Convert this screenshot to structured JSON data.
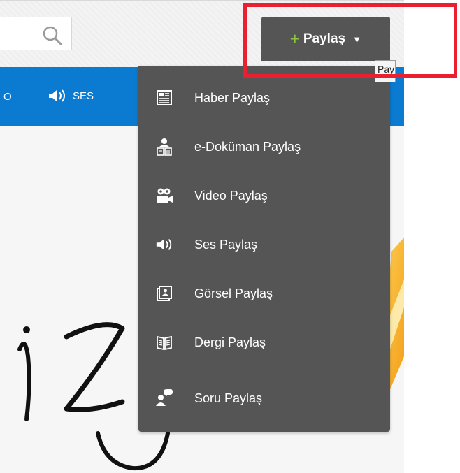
{
  "header": {
    "share_button": {
      "plus": "+",
      "label": "Paylaş",
      "caret": "▼"
    },
    "tooltip": "Paylaş"
  },
  "nav": {
    "item_partial": "O",
    "item_ses": "SES"
  },
  "dropdown": {
    "items": [
      {
        "label": "Haber Paylaş",
        "icon": "newspaper-icon"
      },
      {
        "label": "e-Doküman Paylaş",
        "icon": "document-share-icon"
      },
      {
        "label": "Video Paylaş",
        "icon": "video-camera-icon"
      },
      {
        "label": "Ses Paylaş",
        "icon": "speaker-icon"
      },
      {
        "label": "Görsel Paylaş",
        "icon": "picture-icon"
      },
      {
        "label": "Dergi Paylaş",
        "icon": "magazine-icon"
      },
      {
        "label": "Soru Paylaş",
        "icon": "question-user-icon"
      }
    ]
  },
  "colors": {
    "nav_blue": "#0a7bd0",
    "dropdown_bg": "#555555",
    "plus_green": "#8cc63f",
    "highlight_red": "#e8202f"
  }
}
